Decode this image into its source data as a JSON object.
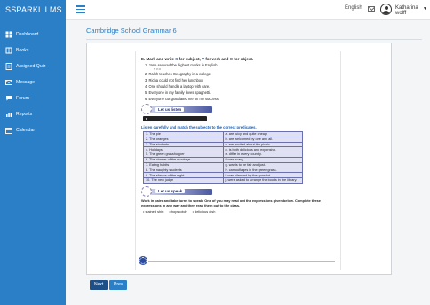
{
  "app": {
    "brand": "SSPARKL LMS"
  },
  "header": {
    "language": "English",
    "user_name": "Katharina wolff"
  },
  "sidebar": {
    "items": [
      {
        "label": "Dashboard",
        "icon": "dashboard-icon"
      },
      {
        "label": "Books",
        "icon": "book-icon"
      },
      {
        "label": "Assigned Quiz",
        "icon": "quiz-icon"
      },
      {
        "label": "Message",
        "icon": "message-icon"
      },
      {
        "label": "Forum",
        "icon": "forum-icon"
      },
      {
        "label": "Reports",
        "icon": "reports-icon"
      },
      {
        "label": "Calendar",
        "icon": "calendar-icon"
      }
    ]
  },
  "page": {
    "title": "Cambridge School Grammar 6"
  },
  "book": {
    "exercise_e": {
      "prefix": "E. Mark and write ",
      "s": "S",
      "mid1": " for subject, ",
      "v": "V",
      "mid2": " for verb and ",
      "o": "O",
      "suffix": " for object.",
      "sentences": [
        "1. Jane secured the highest marks in English.",
        "2. Ralph teaches Geography in a college.",
        "3. Richa could not find her lunchbox.",
        "4. One should handle a laptop with care.",
        "5. Everyone in my family loves spaghetti.",
        "6. Everyone congratulated me on my success."
      ],
      "example_note": "S  V  O"
    },
    "listen_banner": "Let us listen",
    "match_instruction": "Listen carefully and match the subjects to the correct predicates.",
    "match_rows": [
      [
        "1. The pie",
        "a. are juicy and quite cheap."
      ],
      [
        "2. The oranges",
        "b. are welcomed by one and all."
      ],
      [
        "3. The students",
        "c. are excited about the picnic."
      ],
      [
        "4. Holidays",
        "d. is both delicious and expensive."
      ],
      [
        "5. The green grasshopper",
        "e. differ in every country."
      ],
      [
        "6. The charter of the monkeys",
        "f. was scary."
      ],
      [
        "7. Eating habits",
        "g. wants to be fair and just."
      ],
      [
        "8. The naughty students",
        "h. camouflages in the green grass."
      ],
      [
        "9. The silence of the night",
        "i. was silenced by the gunshot."
      ],
      [
        "10. The new judge",
        "j. were asked to arrange the books in the library."
      ]
    ],
    "speak_banner": "Let us speak",
    "speak_text": "Work in pairs and take turns to speak. One of you may read out the expressions given below. Complete these expressions in any way and then read them out to the class.",
    "speak_words": [
      "• stained shirt",
      "• hopscotch",
      "• delicious dish"
    ]
  },
  "nav_buttons": {
    "next": "Next",
    "prev": "Prev"
  },
  "colors": {
    "brand_blue": "#2a7fc7",
    "dark_button": "#1e4f86",
    "table_fill": "#dfe1f3"
  }
}
